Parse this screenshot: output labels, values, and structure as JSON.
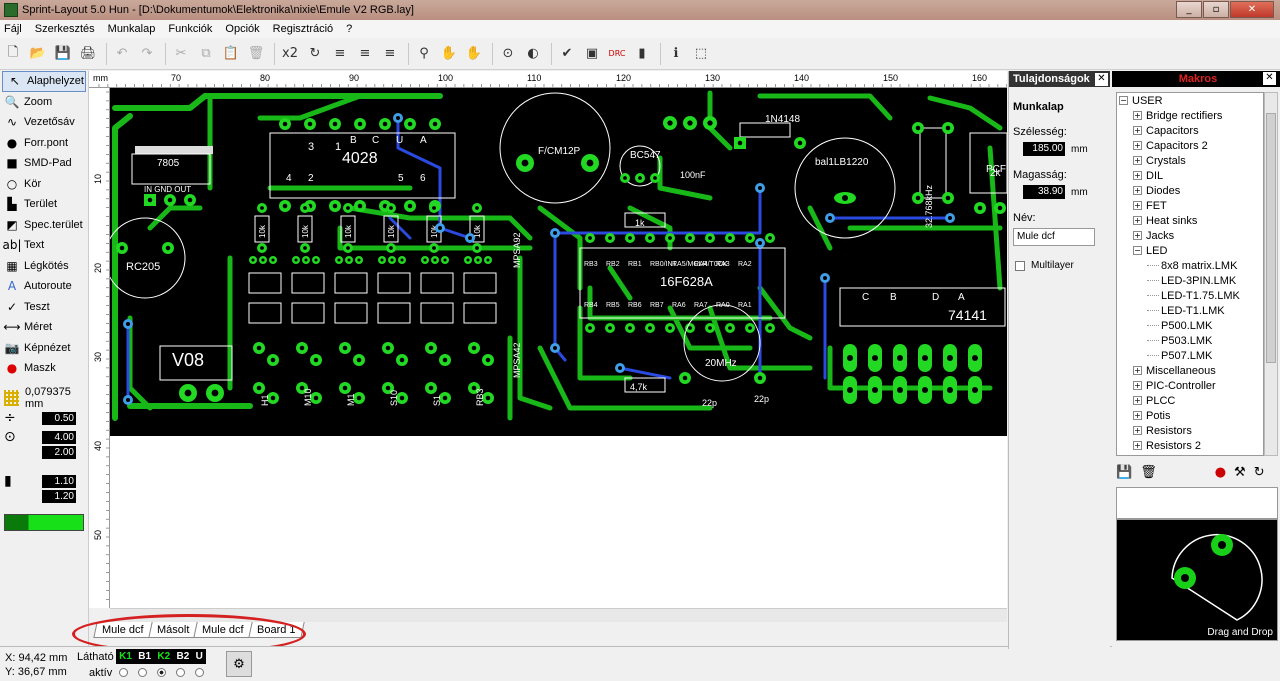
{
  "window": {
    "title": "Sprint-Layout 5.0 Hun    - [D:\\Dokumentumok\\Elektronika\\nixie\\Emule V2 RGB.lay]",
    "min": "_",
    "max": "▫",
    "close": "✕"
  },
  "menu": [
    "Fájl",
    "Szerkesztés",
    "Munkalap",
    "Funkciók",
    "Opciók",
    "Regisztráció",
    "?"
  ],
  "toolbar": [
    "🗋",
    "📂",
    "💾",
    "🖨",
    "|",
    "↶",
    "↷",
    "|",
    "✂",
    "⧉",
    "📋",
    "🗑",
    "|",
    "x2",
    "↻",
    "≡",
    "≡",
    "≡",
    "|",
    "⚲",
    "✋",
    "✋",
    "|",
    "⊙",
    "◐",
    "|",
    "✔",
    "▣",
    "DRC",
    "▮",
    "|",
    "ℹ",
    "⬚"
  ],
  "tools": [
    {
      "icon": "↖",
      "label": "Alaphelyzet",
      "sel": true
    },
    {
      "icon": "🔍",
      "label": "Zoom"
    },
    {
      "icon": "∿",
      "label": "Vezetősáv"
    },
    {
      "icon": "●",
      "label": "Forr.pont"
    },
    {
      "icon": "■",
      "label": "SMD-Pad"
    },
    {
      "icon": "○",
      "label": "Kör"
    },
    {
      "icon": "▙",
      "label": "Terület"
    },
    {
      "icon": "◩",
      "label": "Spec.terület"
    },
    {
      "icon": "ab|",
      "label": "Text"
    },
    {
      "icon": "▦",
      "label": "Légkötés"
    },
    {
      "icon": "A",
      "label": "Autoroute"
    },
    {
      "icon": "✓",
      "label": "Teszt"
    },
    {
      "icon": "⟷",
      "label": "Méret"
    },
    {
      "icon": "📷",
      "label": "Képnézet"
    },
    {
      "icon": "●",
      "label": "Maszk"
    }
  ],
  "grid": "0,079375 mm",
  "params": {
    "track": "0.50",
    "pad_outer": "4.00",
    "pad_inner": "2.00",
    "smd_w": "1.10",
    "smd_h": "1.20"
  },
  "ruler_h": [
    "mm",
    "70",
    "80",
    "90",
    "100",
    "110",
    "120",
    "130",
    "140",
    "150",
    "160"
  ],
  "ruler_v": [
    "10",
    "20",
    "30",
    "40",
    "50"
  ],
  "tabs": [
    "Mule dcf",
    "Másolt",
    "Mule dcf",
    "Board 1"
  ],
  "status": {
    "x": "X:  94,42 mm",
    "y": "Y:  36,67 mm",
    "visible": "Látható",
    "active": "aktív",
    "layers": [
      "K1",
      "B1",
      "K2",
      "B2",
      "U"
    ]
  },
  "props": {
    "title": "Tulajdonságok",
    "section": "Munkalap",
    "width_label": "Szélesség:",
    "width": "185.00",
    "height_label": "Magasság:",
    "height": "38.90",
    "unit": "mm",
    "name_label": "Név:",
    "name": "Mule dcf",
    "multilayer": "Multilayer"
  },
  "macros": {
    "title": "Makros",
    "tree": [
      {
        "t": "USER",
        "l": 0,
        "e": "−"
      },
      {
        "t": "Bridge rectifiers",
        "l": 1,
        "e": "+"
      },
      {
        "t": "Capacitors",
        "l": 1,
        "e": "+"
      },
      {
        "t": "Capacitors 2",
        "l": 1,
        "e": "+"
      },
      {
        "t": "Crystals",
        "l": 1,
        "e": "+"
      },
      {
        "t": "DIL",
        "l": 1,
        "e": "+"
      },
      {
        "t": "Diodes",
        "l": 1,
        "e": "+"
      },
      {
        "t": "FET",
        "l": 1,
        "e": "+"
      },
      {
        "t": "Heat sinks",
        "l": 1,
        "e": "+"
      },
      {
        "t": "Jacks",
        "l": 1,
        "e": "+"
      },
      {
        "t": "LED",
        "l": 1,
        "e": "−"
      },
      {
        "t": "8x8 matrix.LMK",
        "l": 2,
        "e": ""
      },
      {
        "t": "LED-3PIN.LMK",
        "l": 2,
        "e": ""
      },
      {
        "t": "LED-T1.75.LMK",
        "l": 2,
        "e": ""
      },
      {
        "t": "LED-T1.LMK",
        "l": 2,
        "e": ""
      },
      {
        "t": "P500.LMK",
        "l": 2,
        "e": ""
      },
      {
        "t": "P503.LMK",
        "l": 2,
        "e": ""
      },
      {
        "t": "P507.LMK",
        "l": 2,
        "e": ""
      },
      {
        "t": "Miscellaneous",
        "l": 1,
        "e": "+"
      },
      {
        "t": "PIC-Controller",
        "l": 1,
        "e": "+"
      },
      {
        "t": "PLCC",
        "l": 1,
        "e": "+"
      },
      {
        "t": "Potis",
        "l": 1,
        "e": "+"
      },
      {
        "t": "Resistors",
        "l": 1,
        "e": "+"
      },
      {
        "t": "Resistors 2",
        "l": 1,
        "e": "+"
      },
      {
        "t": "SMD",
        "l": 1,
        "e": "+"
      }
    ],
    "dragdrop": "Drag and Drop"
  },
  "pcb": {
    "labels": [
      "7805",
      "IN GND OUT",
      "RC205",
      "4028",
      "3",
      "1",
      "B",
      "C",
      "U",
      "A",
      "4",
      "2",
      "5",
      "6",
      "F/CM12P",
      "BC547",
      "1N4148",
      "bal1LB1220",
      "32.768kHz",
      "100nF",
      "16F628A",
      "74141",
      "20MHz",
      "22p",
      "22p",
      "4,7k",
      "1k",
      "10k",
      "10k",
      "10k",
      "10k",
      "10k",
      "10k",
      "MPSA92",
      "MPSA42",
      "V08",
      "H10",
      "H1",
      "M10",
      "M1",
      "S10",
      "S1",
      "RB3",
      "RB2",
      "RB1",
      "RB0/INT",
      "RA5/MCLR",
      "RA4/T0CK",
      "RA3",
      "RA2",
      "RB4",
      "RB5",
      "RB6",
      "RB7",
      "RA6",
      "RA7",
      "RA0",
      "RA1",
      "C",
      "B",
      "D",
      "A",
      "PCF",
      "2k"
    ]
  }
}
